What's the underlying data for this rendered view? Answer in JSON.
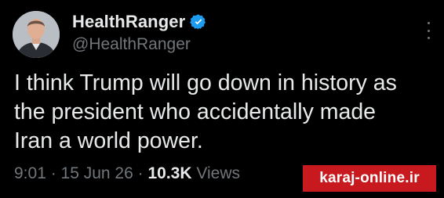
{
  "tweet": {
    "author": {
      "display_name": "HealthRanger",
      "handle": "@HealthRanger",
      "verified": true,
      "verified_color": "#1d9bf0",
      "avatar": "profile-photo"
    },
    "text": "I think Trump will go down in history as\nthe president who accidentally made\nIran a world power.",
    "time": "9:01",
    "date": "15 Jun 26",
    "views_count": "10.3K",
    "views_label": "Views",
    "separator": " · "
  },
  "menu": {
    "icon": "more-vertical-icon"
  },
  "watermark": {
    "text": "karaj-online.ir",
    "background": "#c8191f"
  },
  "colors": {
    "background": "#000000",
    "primary_text": "#e7e9ea",
    "secondary_text": "#71767b"
  }
}
